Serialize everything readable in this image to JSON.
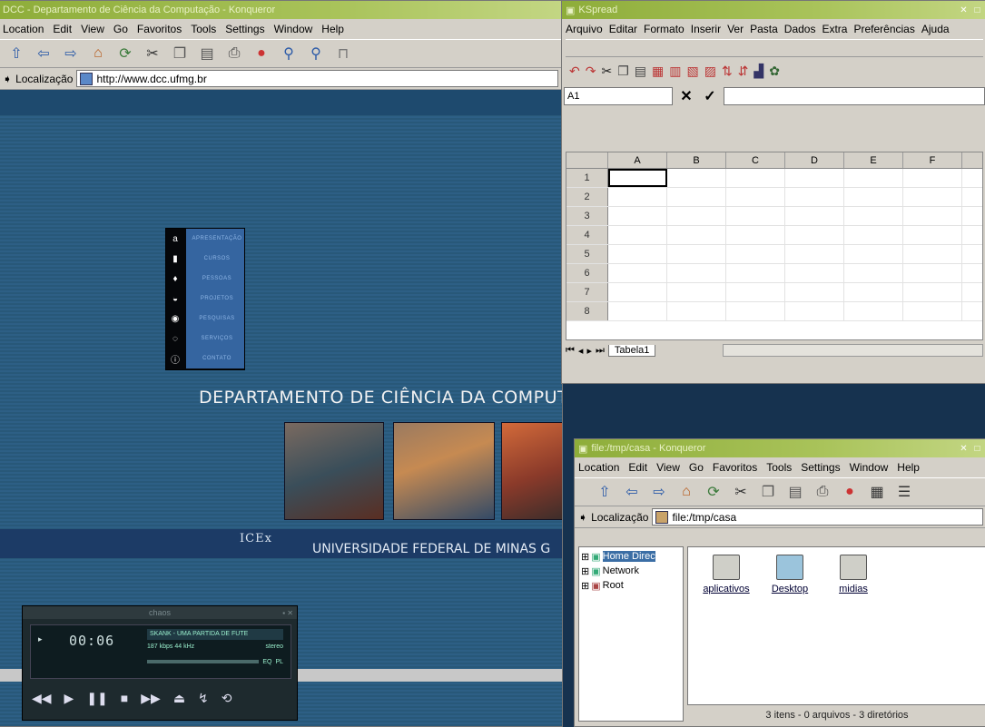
{
  "konqueror": {
    "title": "DCC - Departamento de Ciência da Computação - Konqueror",
    "menu": [
      "Location",
      "Edit",
      "View",
      "Go",
      "Favoritos",
      "Tools",
      "Settings",
      "Window",
      "Help"
    ],
    "location_label": "Localização",
    "url": "http://www.dcc.ufmg.br"
  },
  "site": {
    "nav": [
      {
        "icon": "a",
        "label": "APRESENTAÇÃO"
      },
      {
        "icon": "▮",
        "label": "CURSOS"
      },
      {
        "icon": "♦",
        "label": "PESSOAS"
      },
      {
        "icon": "◒",
        "label": "PROJETOS"
      },
      {
        "icon": "◉",
        "label": "PESQUISAS"
      },
      {
        "icon": "◌",
        "label": "SERVIÇOS"
      },
      {
        "icon": "ⓘ",
        "label": "CONTATO"
      }
    ],
    "department": "DEPARTAMENTO DE CIÊNCIA DA COMPUTAÇÃO",
    "icex": "ICEx",
    "university": "UNIVERSIDADE FEDERAL DE MINAS G"
  },
  "player": {
    "title": "chaos",
    "time": "00:06",
    "song": "SKANK - UMA PARTIDA DE FUTE",
    "bitrate": "187 kbps  44 kHz",
    "mode": "stereo",
    "eq": "EQ",
    "pl": "PL"
  },
  "kspread": {
    "title": "KSpread",
    "menu": [
      "Arquivo",
      "Editar",
      "Formato",
      "Inserir",
      "Ver",
      "Pasta",
      "Dados",
      "Extra",
      "Preferências",
      "Ajuda"
    ],
    "cell_ref": "A1",
    "columns": [
      "A",
      "B",
      "C",
      "D",
      "E",
      "F"
    ],
    "rows": [
      "1",
      "2",
      "3",
      "4",
      "5",
      "6",
      "7",
      "8"
    ],
    "sheet_tab": "Tabela1"
  },
  "konq2": {
    "title": "file:/tmp/casa - Konqueror",
    "menu": [
      "Location",
      "Edit",
      "View",
      "Go",
      "Favoritos",
      "Tools",
      "Settings",
      "Window",
      "Help"
    ],
    "location_label": "Localização",
    "url": "file:/tmp/casa",
    "tree": [
      {
        "label": "Home Direc",
        "selected": true
      },
      {
        "label": "Network",
        "selected": false
      },
      {
        "label": "Root",
        "selected": false
      }
    ],
    "files": [
      "aplicativos",
      "Desktop",
      "midias"
    ],
    "status": "3 itens - 0 arquivos - 3 diretórios"
  }
}
